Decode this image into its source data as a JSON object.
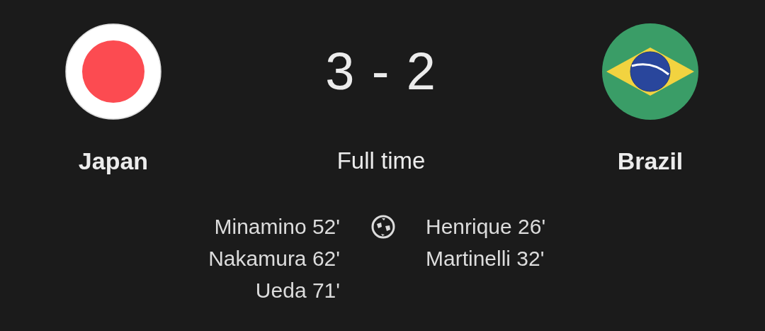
{
  "home": {
    "name": "Japan",
    "kind": "japan"
  },
  "away": {
    "name": "Brazil",
    "kind": "brazil"
  },
  "score": "3 - 2",
  "status": "Full time",
  "home_scorers": [
    "Minamino 52'",
    "Nakamura 62'",
    "Ueda 71'"
  ],
  "away_scorers": [
    "Henrique 26'",
    "Martinelli 32'"
  ]
}
